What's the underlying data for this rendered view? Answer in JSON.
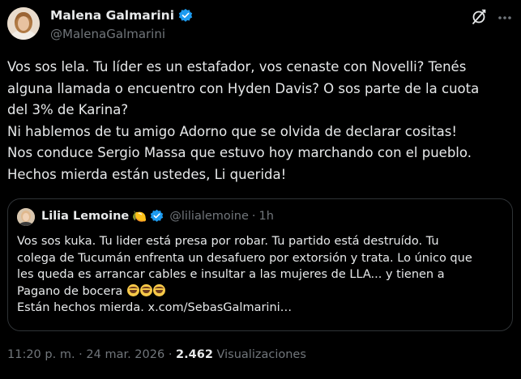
{
  "author": {
    "name": "Malena Galmarini",
    "handle": "@MalenaGalmarini",
    "verified_color": "#1d9bf0"
  },
  "icons": {
    "grok": "grok-icon",
    "more": "more-options-icon",
    "verified": "verified-badge-icon"
  },
  "tweet": {
    "lines": [
      "Vos sos lela. Tu líder es un estafador, vos cenaste con Novelli? Tenés",
      "alguna llamada o encuentro con Hyden Davis? O sos parte de la cuota",
      "del 3% de Karina?",
      "Ni hablemos de tu amigo Adorno que se olvida de declarar cositas!",
      "Nos conduce Sergio Massa que estuvo hoy marchando con el pueblo.",
      "Hechos mierda están ustedes, Li querida!"
    ]
  },
  "quote": {
    "name": "Lilia Lemoine",
    "name_emoji": "🍋",
    "handle": "@lilialemoine",
    "separator": "·",
    "time": "1h",
    "lines": [
      "Vos sos kuka. Tu lider está presa por robar. Tu partido está destruído. Tu",
      "colega de Tucumán enfrenta un desafuero por extorsión y trata. Lo único que",
      "les queda es arrancar cables e insultar a las mujeres de LLA... y tienen a",
      "Pagano de bocera",
      "Están hechos mierda. x.com/SebasGalmarini…"
    ],
    "laugh_emoji_name": "rolling-on-floor-laughing-emoji",
    "laugh_emoji_count": 3
  },
  "meta": {
    "time": "11:20 p. m.",
    "separator": "·",
    "date": "24 mar. 2026",
    "views_count": "2.462",
    "views_label": "Visualizaciones"
  },
  "colors": {
    "background": "#000000",
    "text": "#e7e9ea",
    "secondary_text": "#71767b",
    "border": "#2f3336",
    "accent": "#1d9bf0"
  }
}
